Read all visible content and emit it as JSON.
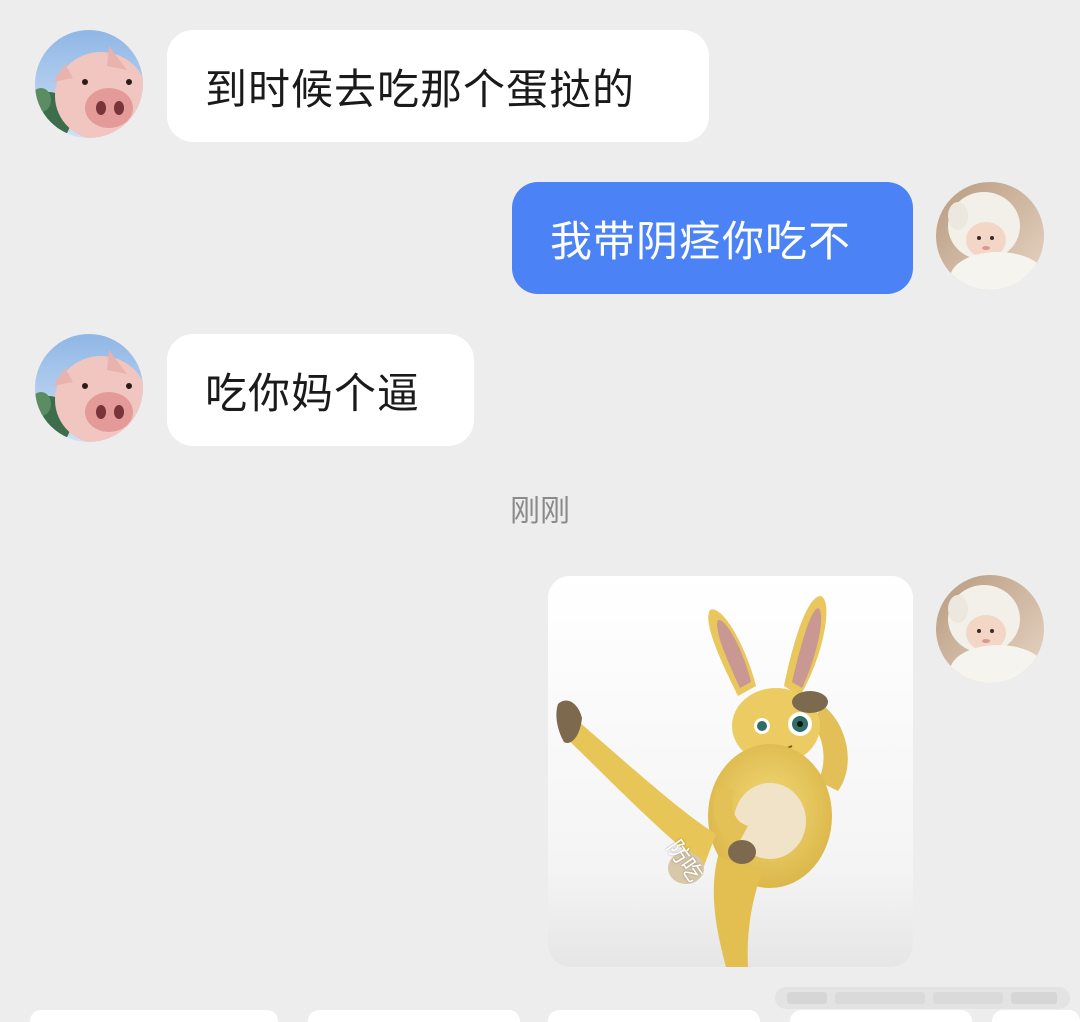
{
  "messages": [
    {
      "side": "left",
      "text": "到时候去吃那个蛋挞的"
    },
    {
      "side": "right",
      "text": "我带阴痉你吃不"
    },
    {
      "side": "left",
      "text": "吃你妈个逼"
    }
  ],
  "timestamp": "刚刚",
  "sticker": {
    "caption": "防吃"
  },
  "colors": {
    "background": "#ededed",
    "incoming_bubble": "#ffffff",
    "outgoing_bubble": "#4b82f6"
  },
  "icons": {
    "left_avatar": "pig-avatar",
    "right_avatar": "baby-avatar"
  }
}
